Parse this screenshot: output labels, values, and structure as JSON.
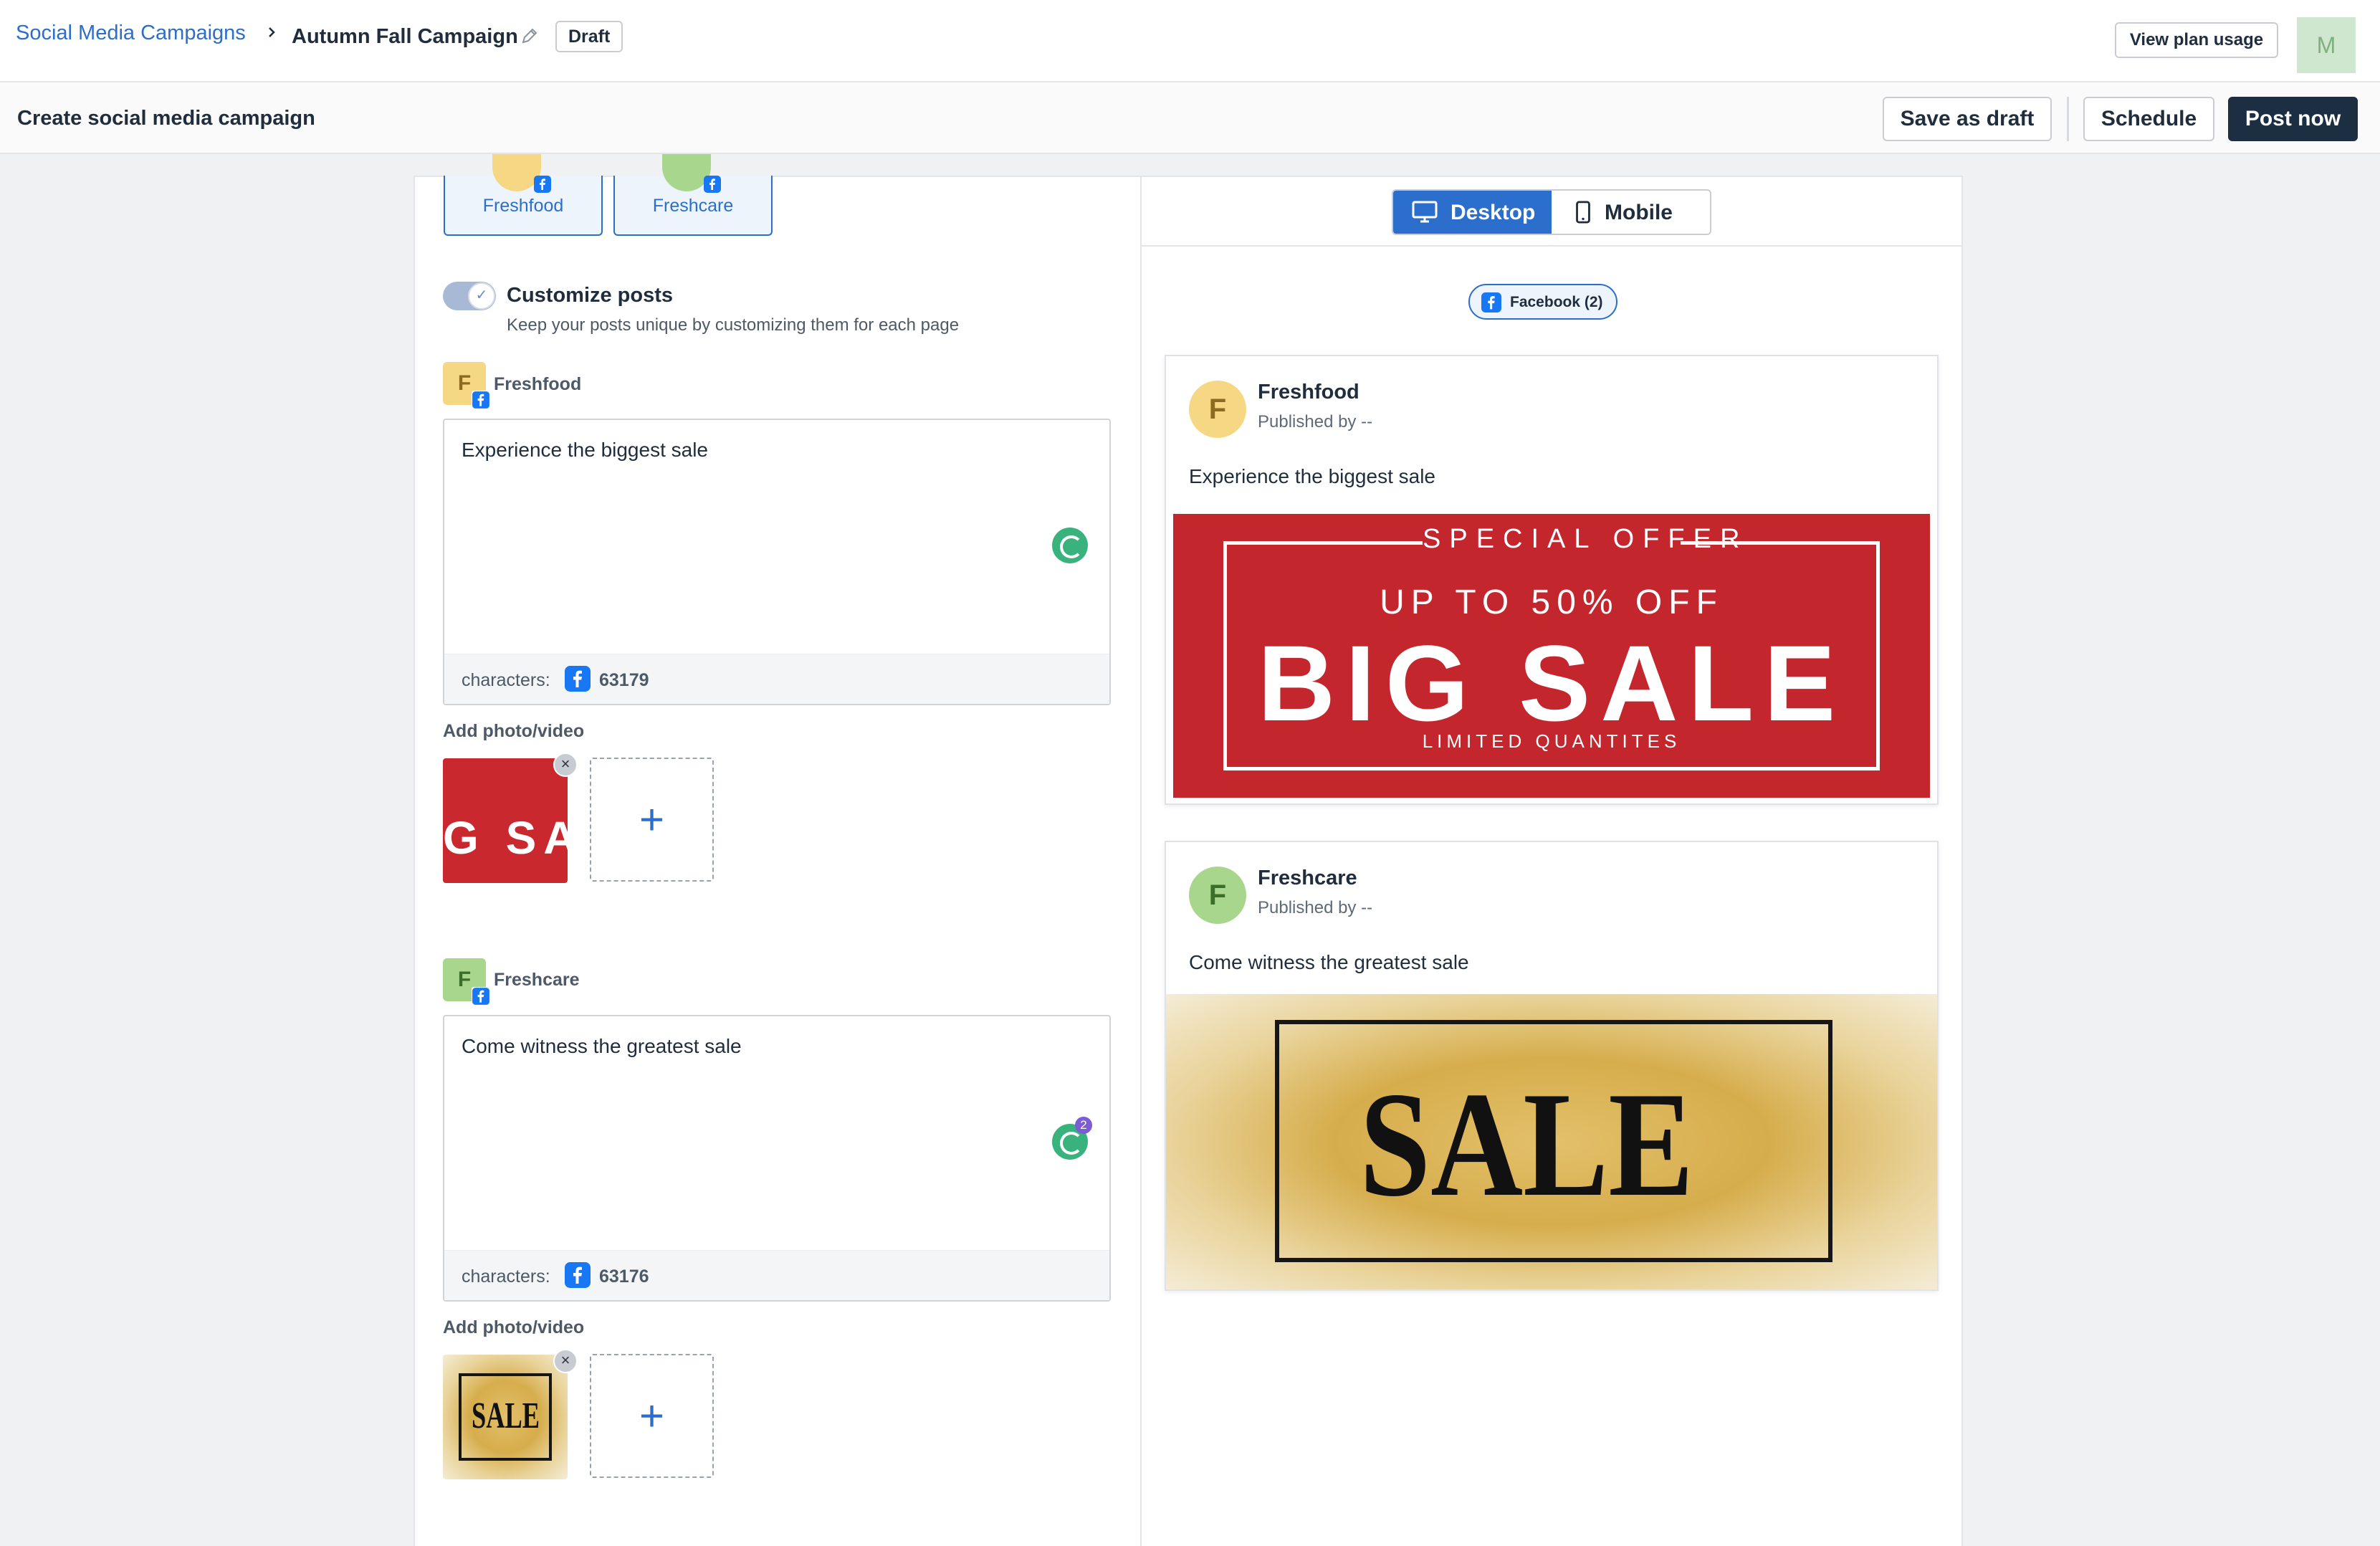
{
  "header": {
    "breadcrumb_link": "Social Media Campaigns",
    "campaign_title": "Autumn Fall Campaign",
    "status_badge": "Draft",
    "plan_usage_label": "View plan usage",
    "avatar_initial": "M"
  },
  "actionbar": {
    "title": "Create social media campaign",
    "save_draft_label": "Save as draft",
    "schedule_label": "Schedule",
    "post_now_label": "Post now"
  },
  "page_chips": [
    {
      "label": "Freshfood"
    },
    {
      "label": "Freshcare"
    }
  ],
  "customize": {
    "title": "Customize posts",
    "description": "Keep your posts unique by customizing them for each page",
    "enabled": true
  },
  "posts": [
    {
      "page_initial": "F",
      "page_name": "Freshfood",
      "text": "Experience the biggest sale",
      "characters_label": "characters:",
      "characters_count": "63179",
      "media_label": "Add photo/video",
      "thumb_text": "G SA",
      "add_symbol": "+",
      "remove_symbol": "×"
    },
    {
      "page_initial": "F",
      "page_name": "Freshcare",
      "text": "Come witness the greatest sale",
      "characters_label": "characters:",
      "characters_count": "63176",
      "media_label": "Add photo/video",
      "thumb_text": "SALE",
      "grammarly_badge": "2",
      "add_symbol": "+",
      "remove_symbol": "×"
    }
  ],
  "preview": {
    "desktop_label": "Desktop",
    "mobile_label": "Mobile",
    "network_pill": "Facebook (2)",
    "cards": [
      {
        "initial": "F",
        "name": "Freshfood",
        "published_by": "Published by --",
        "text": "Experience the biggest sale",
        "image": {
          "special": "SPECIAL OFFER",
          "upto": "UP TO 50% OFF",
          "big": "BIG SALE",
          "limited": "LIMITED QUANTITES"
        }
      },
      {
        "initial": "F",
        "name": "Freshcare",
        "published_by": "Published by --",
        "text": "Come witness the greatest sale",
        "image": {
          "word": "SALE"
        }
      }
    ]
  },
  "colors": {
    "accent": "#2c6ecb",
    "primary_button": "#1b2e42",
    "facebook": "#1877f2",
    "grammarly": "#3ab27d",
    "freshfood_avatar": "#f6d783",
    "freshcare_avatar": "#a9d68d"
  },
  "icons": [
    "chevron-right-icon",
    "pencil-icon",
    "facebook-icon",
    "check-icon",
    "grammarly-icon",
    "close-icon",
    "plus-icon",
    "desktop-icon",
    "mobile-icon"
  ]
}
